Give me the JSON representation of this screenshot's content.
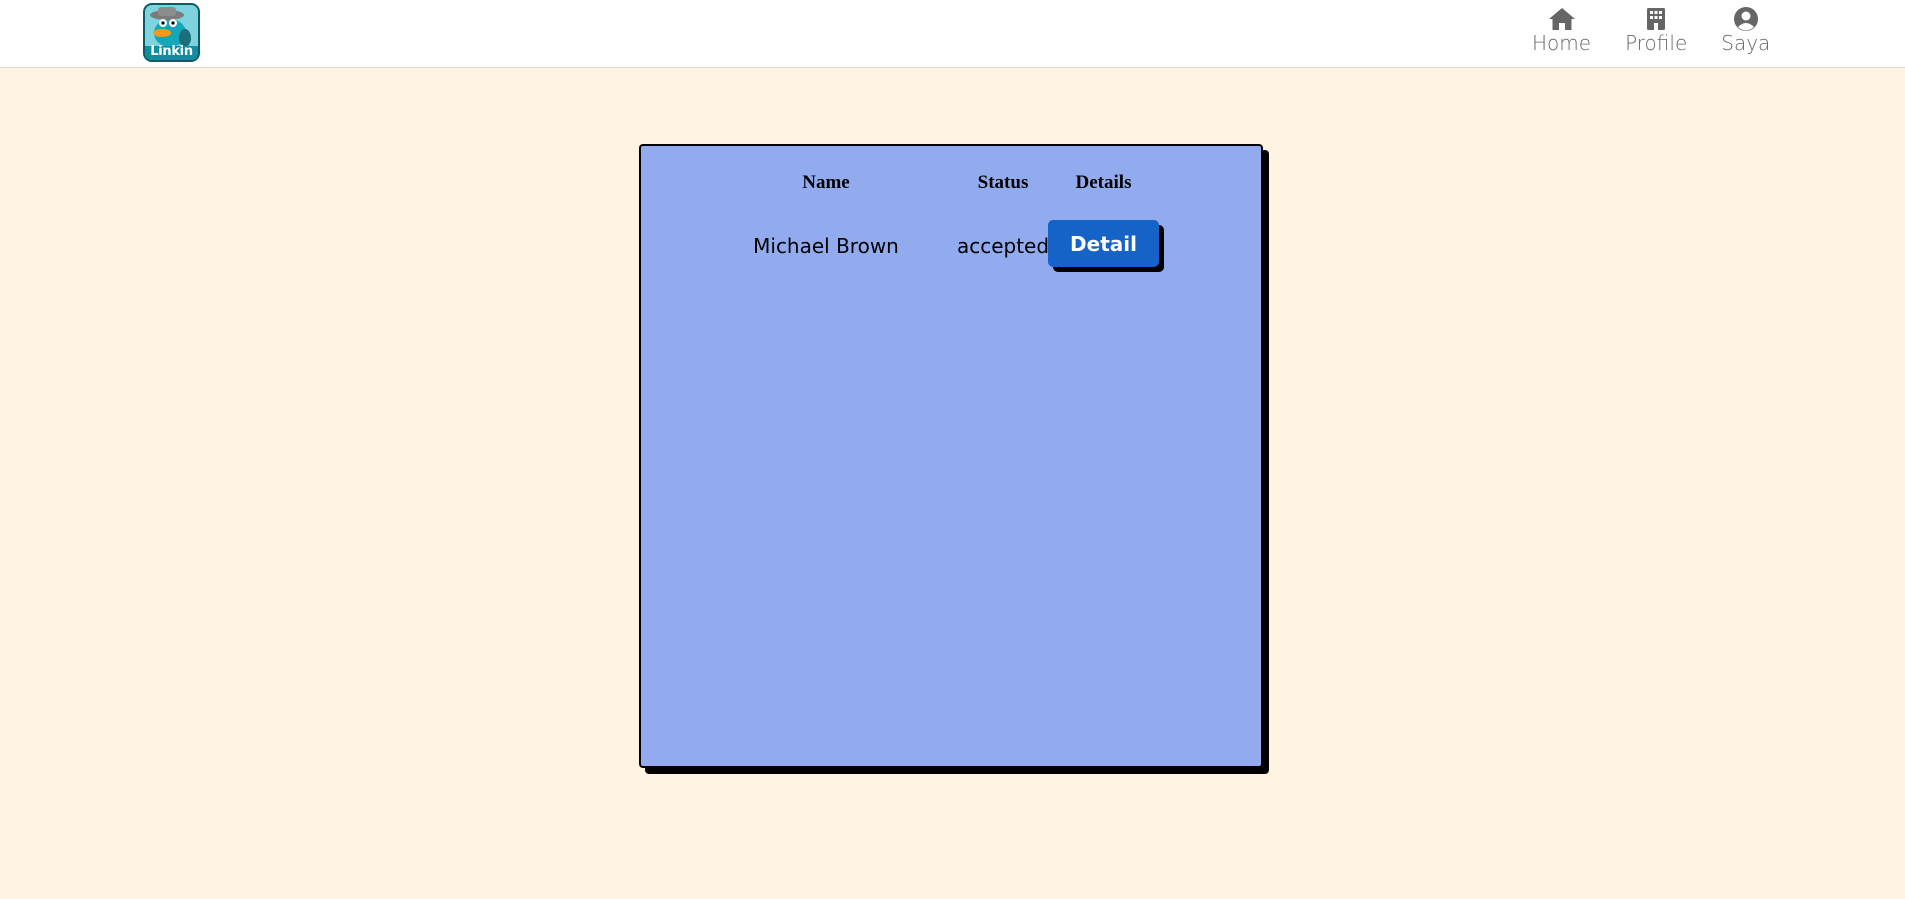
{
  "navbar": {
    "logo_text": "Linkin",
    "items": [
      {
        "label": "Home",
        "icon": "home-icon"
      },
      {
        "label": "Profile",
        "icon": "building-icon"
      },
      {
        "label": "Saya",
        "icon": "user-circle-icon"
      }
    ]
  },
  "table": {
    "headers": {
      "name": "Name",
      "status": "Status",
      "details": "Details"
    },
    "rows": [
      {
        "name": "Michael Brown",
        "status": "accepted",
        "action_label": "Detail"
      }
    ]
  },
  "colors": {
    "page_background": "#fff3e3",
    "card_background": "#91abee",
    "button_background": "#1563c7",
    "icon_color": "#666666"
  }
}
